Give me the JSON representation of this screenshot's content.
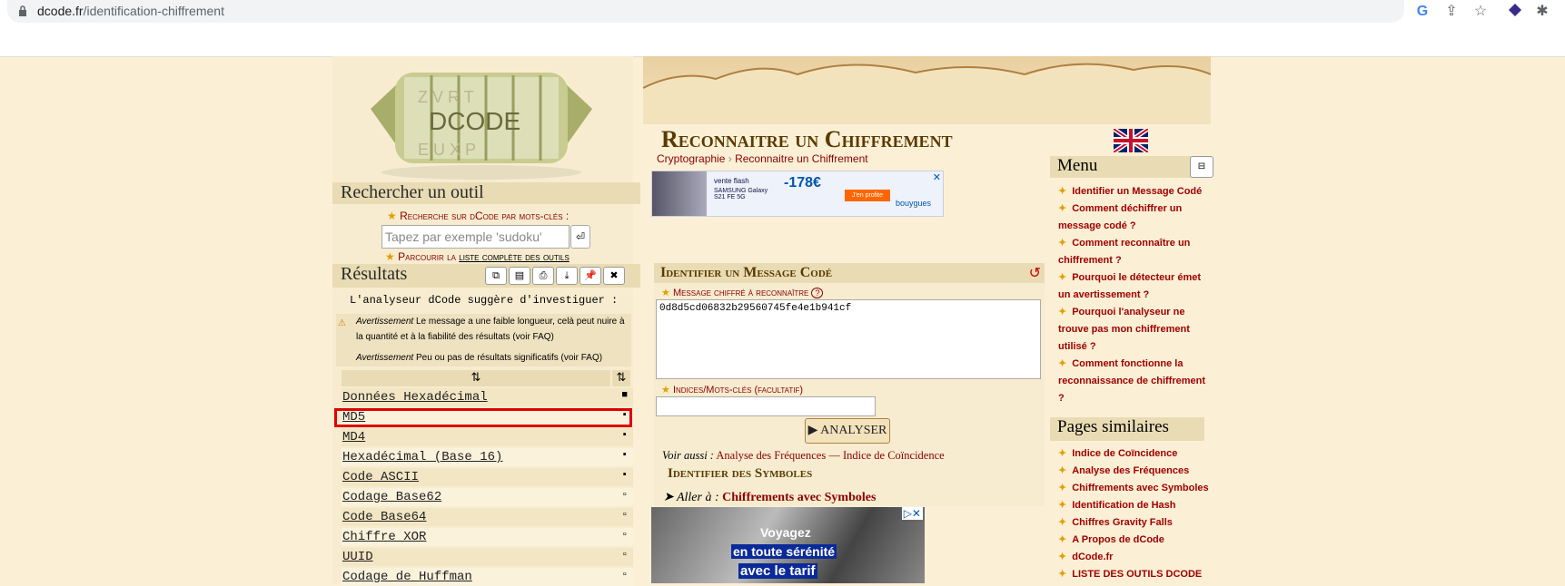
{
  "browser": {
    "url_host": "dcode.fr",
    "url_path": "/identification-chiffrement"
  },
  "logo": {
    "letters": "DCODE"
  },
  "search": {
    "title": "Rechercher un outil",
    "keyword_label": "Recherche sur dCode par mots-clés :",
    "placeholder": "Tapez par exemple 'sudoku'",
    "browse_prefix": "Parcourir la",
    "browse_link": "liste complète des outils"
  },
  "results": {
    "title": "Résultats",
    "suggest": "L'analyseur dCode suggère d'investiguer :",
    "warn1_label": "Avertissement",
    "warn1_text": "Le message a une faible longueur, celà peut nuire à la quantité et à la fiabilité des résultats (voir FAQ)",
    "warn2_label": "Avertissement",
    "warn2_text": "Peu ou pas de résultats significatifs (voir FAQ)",
    "sort_icon": "↕",
    "items": [
      {
        "name": "Données Hexadécimal",
        "mark": "■"
      },
      {
        "name": "MD5",
        "mark": "▪"
      },
      {
        "name": "MD4",
        "mark": "▪"
      },
      {
        "name": "Hexadécimal (Base 16)",
        "mark": "▪"
      },
      {
        "name": "Code ASCII",
        "mark": "▪"
      },
      {
        "name": "Codage Base62",
        "mark": "▫"
      },
      {
        "name": "Code Base64",
        "mark": "▫"
      },
      {
        "name": "Chiffre XOR",
        "mark": "▫"
      },
      {
        "name": "UUID",
        "mark": "▫"
      },
      {
        "name": "Codage de Huffman",
        "mark": "▫"
      }
    ]
  },
  "page": {
    "title": "Reconnaitre un Chiffrement",
    "breadcrumb1": "Cryptographie",
    "breadcrumb2": "Reconnaitre un Chiffrement"
  },
  "ad1": {
    "brand": "vente flash",
    "product": "SAMSUNG Galaxy S21 FE 5G",
    "price": "-178€",
    "cta": "J'en profite",
    "company": "bouygues"
  },
  "tool": {
    "title": "Identifier un Message Codé",
    "msg_label": "Message chiffré à reconnaître",
    "msg_value": "0d8d5cd06832b29560745fe4e1b941cf",
    "hint_label": "Indices/Mots-clés (facultatif)",
    "analyze_button": "▶ ANALYSER",
    "see_also_prefix": "Voir aussi :",
    "see_also_1": "Analyse des Fréquences",
    "see_also_sep": "—",
    "see_also_2": "Indice de Coïncidence",
    "symbols_title": "Identifier des Symboles",
    "goto_prefix": "➤ Aller à :",
    "goto_link": "Chiffrements avec Symboles"
  },
  "ad2": {
    "line1": "Voyagez",
    "line2": "en toute sérénité",
    "line3": "avec le tarif"
  },
  "menu": {
    "title": "Menu",
    "items": [
      "Identifier un Message Codé",
      "Comment déchiffrer un message codé ?",
      "Comment reconnaître un chiffrement ?",
      "Pourquoi le détecteur émet un avertissement ?",
      "Pourquoi l'analyseur ne trouve pas mon chiffrement utilisé ?",
      "Comment fonctionne la reconnaissance de chiffrement ?"
    ]
  },
  "similar": {
    "title": "Pages similaires",
    "items": [
      "Indice de Coïncidence",
      "Analyse des Fréquences",
      "Chiffrements avec Symboles",
      "Identification de Hash",
      "Chiffres Gravity Falls",
      "A Propos de dCode",
      "dCode.fr",
      "LISTE DES OUTILS DCODE"
    ]
  },
  "colors": {
    "accent": "#8b0000",
    "highlight": "#e00000",
    "parchment": "#f7ecd0"
  }
}
